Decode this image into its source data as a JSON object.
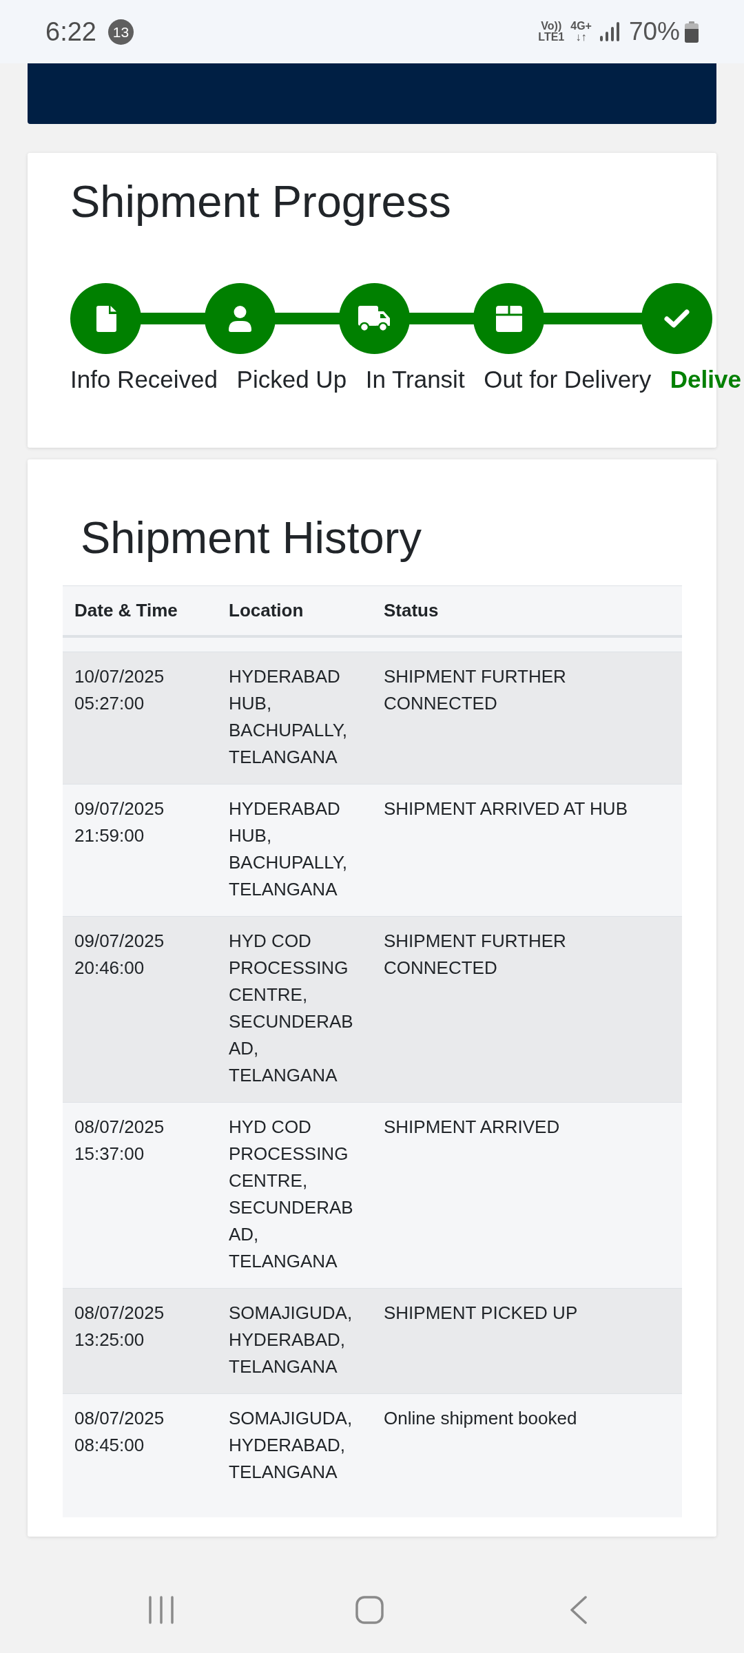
{
  "status_bar": {
    "time": "6:22",
    "notification_count": "13",
    "volte": {
      "top": "Vo))",
      "bottom": "LTE1"
    },
    "network": {
      "top": "4G+",
      "bottom": "↓↑"
    },
    "battery_text": "70%"
  },
  "progress": {
    "title": "Shipment Progress",
    "steps": [
      {
        "label": "Info Received",
        "done": true,
        "current": false
      },
      {
        "label": "Picked Up",
        "done": true,
        "current": false
      },
      {
        "label": "In Transit",
        "done": true,
        "current": false
      },
      {
        "label": "Out for Delivery",
        "done": true,
        "current": false
      },
      {
        "label": "Delive",
        "done": true,
        "current": true
      }
    ]
  },
  "history": {
    "title": "Shipment History",
    "columns": [
      "Date & Time",
      "Location",
      "Status"
    ],
    "rows": [
      {
        "date_time": "10/07/2025 05:27:00",
        "location": "HYDERABAD HUB, BACHUPALLY, TELANGANA",
        "status": "SHIPMENT FURTHER CONNECTED"
      },
      {
        "date_time": "09/07/2025 21:59:00",
        "location": "HYDERABAD HUB, BACHUPALLY, TELANGANA",
        "status": "SHIPMENT ARRIVED AT HUB"
      },
      {
        "date_time": "09/07/2025 20:46:00",
        "location": "HYD COD PROCESSING CENTRE, SECUNDERABAD, TELANGANA",
        "status": "SHIPMENT FURTHER CONNECTED"
      },
      {
        "date_time": "08/07/2025 15:37:00",
        "location": "HYD COD PROCESSING CENTRE, SECUNDERABAD, TELANGANA",
        "status": "SHIPMENT ARRIVED"
      },
      {
        "date_time": "08/07/2025 13:25:00",
        "location": "SOMAJIGUDA, HYDERABAD, TELANGANA",
        "status": "SHIPMENT PICKED UP"
      },
      {
        "date_time": "08/07/2025 08:45:00",
        "location": "SOMAJIGUDA, HYDERABAD, TELANGANA",
        "status": "Online shipment booked"
      }
    ]
  }
}
